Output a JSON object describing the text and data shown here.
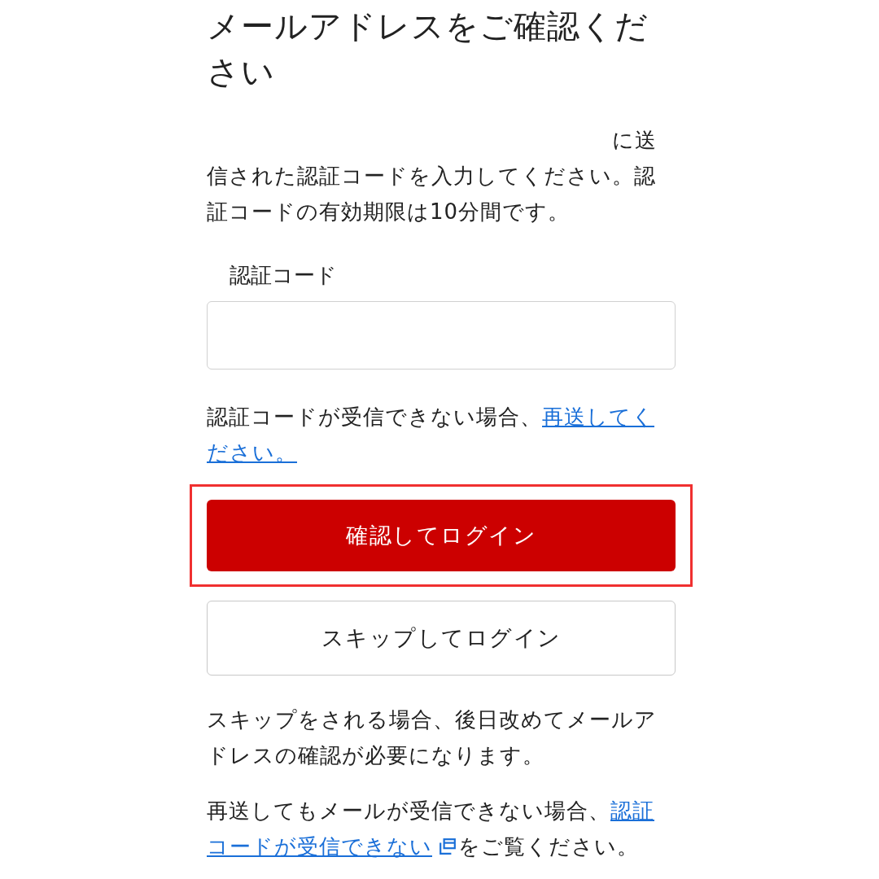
{
  "heading": "メールアドレスをご確認ください",
  "instructions": "に送信された認証コードを入力してください。認証コードの有効期限は10分間です。",
  "code_field": {
    "label": "認証コード"
  },
  "resend_note": {
    "text": "認証コードが受信できない場合、",
    "link": "再送してください。"
  },
  "buttons": [
    {
      "label": "確認してログイン",
      "kind": "primary",
      "highlighted": true
    },
    {
      "label": "スキップしてログイン",
      "kind": "secondary",
      "highlighted": false
    }
  ],
  "skip_note": "スキップをされる場合、後日改めてメールアドレスの確認が必要になります。",
  "help_note": {
    "text": "再送してもメールが受信できない場合、",
    "link": "認証コードが受信できない",
    "after": "をご覧ください。"
  }
}
